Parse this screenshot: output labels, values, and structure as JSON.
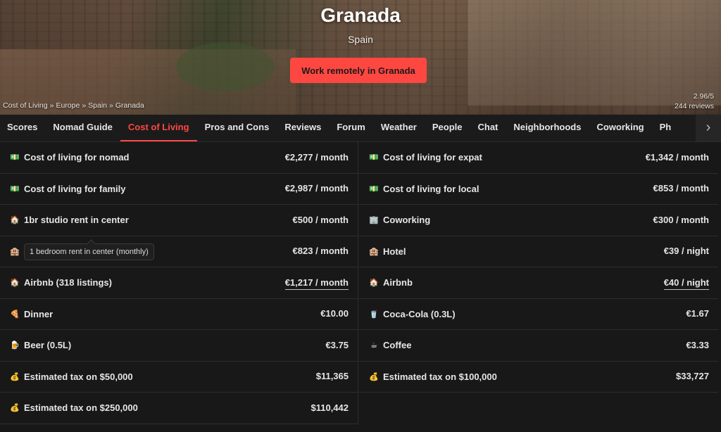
{
  "hero": {
    "title": "Granada",
    "subtitle": "Spain",
    "cta_label": "Work remotely in Granada",
    "rating": "2.96/5",
    "reviews": "244 reviews"
  },
  "breadcrumb": [
    "Cost of Living",
    "Europe",
    "Spain",
    "Granada"
  ],
  "tabs": [
    {
      "label": "Scores"
    },
    {
      "label": "Nomad Guide"
    },
    {
      "label": "Cost of Living",
      "active": true
    },
    {
      "label": "Pros and Cons"
    },
    {
      "label": "Reviews"
    },
    {
      "label": "Forum"
    },
    {
      "label": "Weather"
    },
    {
      "label": "People"
    },
    {
      "label": "Chat"
    },
    {
      "label": "Neighborhoods"
    },
    {
      "label": "Coworking"
    },
    {
      "label": "Ph"
    }
  ],
  "tab_next_icon": "chevron-right-icon",
  "left": [
    {
      "icon": "money-icon",
      "glyph": "💵",
      "label": "Cost of living for nomad",
      "value": "€2,277 / month"
    },
    {
      "icon": "money-icon",
      "glyph": "💵",
      "label": "Cost of living for family",
      "value": "€2,987 / month"
    },
    {
      "icon": "house-icon",
      "glyph": "🏠",
      "label": "1br studio rent in center",
      "value": "€500 / month"
    },
    {
      "icon": "hotel-icon",
      "glyph": "🏨",
      "label": "",
      "value": "€823 / month"
    },
    {
      "icon": "house-icon",
      "glyph": "🏠",
      "label": "Airbnb (318 listings)",
      "value": "€1,217 / month",
      "underline": true
    },
    {
      "icon": "pizza-icon",
      "glyph": "🍕",
      "label": "Dinner",
      "value": "€10.00"
    },
    {
      "icon": "beer-icon",
      "glyph": "🍺",
      "label": "Beer (0.5L)",
      "value": "€3.75"
    },
    {
      "icon": "money-bag-icon",
      "glyph": "💰",
      "label": "Estimated tax on $50,000",
      "value": "$11,365"
    },
    {
      "icon": "money-bag-icon",
      "glyph": "💰",
      "label": "Estimated tax on $250,000",
      "value": "$110,442"
    }
  ],
  "right": [
    {
      "icon": "money-icon",
      "glyph": "💵",
      "label": "Cost of living for expat",
      "value": "€1,342 / month"
    },
    {
      "icon": "money-icon",
      "glyph": "💵",
      "label": "Cost of living for local",
      "value": "€853 / month"
    },
    {
      "icon": "office-icon",
      "glyph": "🏢",
      "label": "Coworking",
      "value": "€300 / month"
    },
    {
      "icon": "hotel-icon",
      "glyph": "🏨",
      "label": "Hotel",
      "value": "€39 / night"
    },
    {
      "icon": "house-icon",
      "glyph": "🏠",
      "label": "Airbnb",
      "value": "€40 / night",
      "underline": true
    },
    {
      "icon": "cup-icon",
      "glyph": "🥤",
      "label": "Coca-Cola (0.3L)",
      "value": "€1.67"
    },
    {
      "icon": "coffee-icon",
      "glyph": "☕",
      "label": "Coffee",
      "value": "€3.33"
    },
    {
      "icon": "money-bag-icon",
      "glyph": "💰",
      "label": "Estimated tax on $100,000",
      "value": "$33,727"
    }
  ],
  "tooltip": "1 bedroom rent in center (monthly)",
  "colors": {
    "accent": "#ff4742",
    "background": "#181818"
  }
}
